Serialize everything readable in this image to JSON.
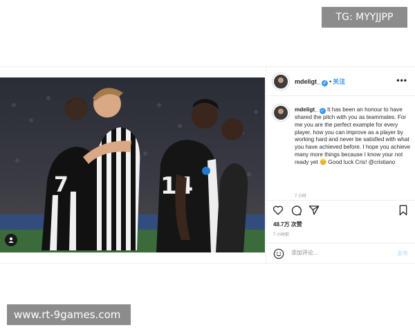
{
  "overlay": {
    "telegram": "TG: MYYJJPP",
    "website": "www.rt-9games.com"
  },
  "post": {
    "username": "mdeligt_",
    "verified_icon": "verified-badge-icon",
    "separator": "•",
    "follow_label": "关注",
    "more_label": "•••",
    "caption": {
      "username": "mdeligt_",
      "text": "It has been an honour to have shared the pitch with you as teammates. For me you are the perfect example for every player, how you can improve as a player by working hard and never be satisfied with what you have achieved before. I hope you achieve many more things because I know your not ready yet 😊 Good luck Cris! @cristiano",
      "time": "7 小时"
    },
    "likes": "48.7万 次赞",
    "time_ago": "7 小时前",
    "comment": {
      "placeholder": "添加评论...",
      "post_label": "发布"
    },
    "icons": [
      "heart-icon",
      "comment-icon",
      "share-icon",
      "bookmark-icon",
      "emoji-icon",
      "user-tag-icon"
    ],
    "colors": {
      "accent": "#3897f0",
      "post_disabled": "#b3dbff"
    }
  }
}
